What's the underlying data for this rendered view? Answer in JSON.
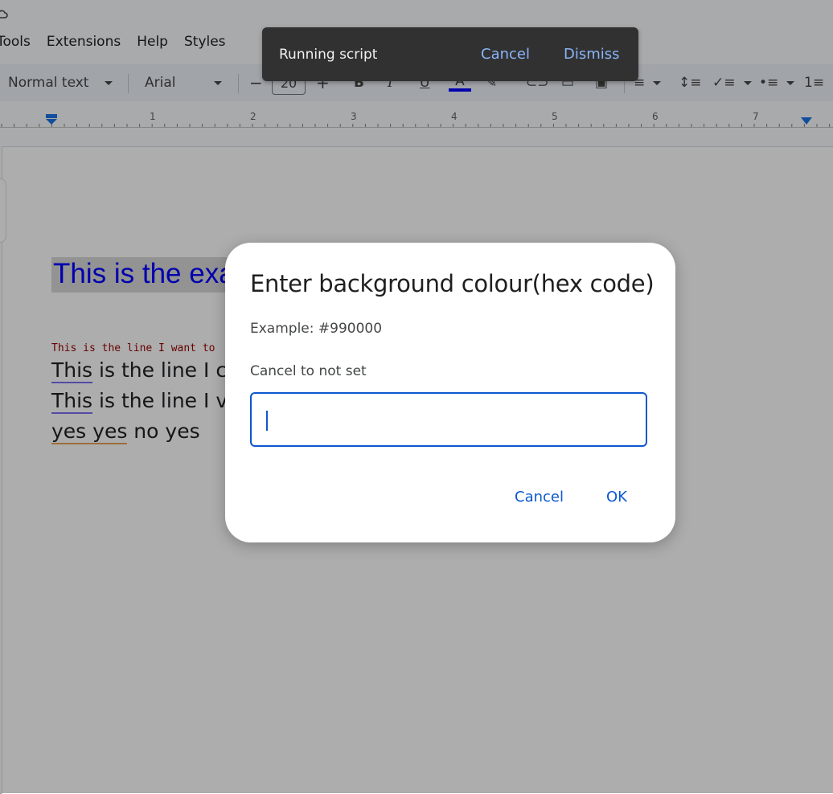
{
  "menu": [
    "Tools",
    "Extensions",
    "Help",
    "Styles"
  ],
  "toolbar": {
    "style_select": "Normal text",
    "font_select": "Arial",
    "font_size": "20",
    "minus": "−",
    "plus": "+"
  },
  "ruler": [
    "1",
    "2",
    "3",
    "4",
    "5",
    "6",
    "7"
  ],
  "document": {
    "heading": "This is the exa",
    "mono_line": "This is the line I want to",
    "line1_a": "This",
    "line1_b": " is the line I c",
    "line2_a": "This",
    "line2_b": " is the line I v",
    "line3_a": "yes yes",
    "line3_b": " no yes"
  },
  "snackbar": {
    "text": "Running script",
    "cancel": "Cancel",
    "dismiss": "Dismiss"
  },
  "dialog": {
    "title": "Enter background colour(hex code)",
    "example": "Example: #990000",
    "hint": "Cancel to not set",
    "input_value": "",
    "cancel": "Cancel",
    "ok": "OK"
  },
  "colors": {
    "accent": "#0b57d0",
    "heading": "#0000ff",
    "mono": "#990000",
    "snackbar_bg": "#313131"
  }
}
